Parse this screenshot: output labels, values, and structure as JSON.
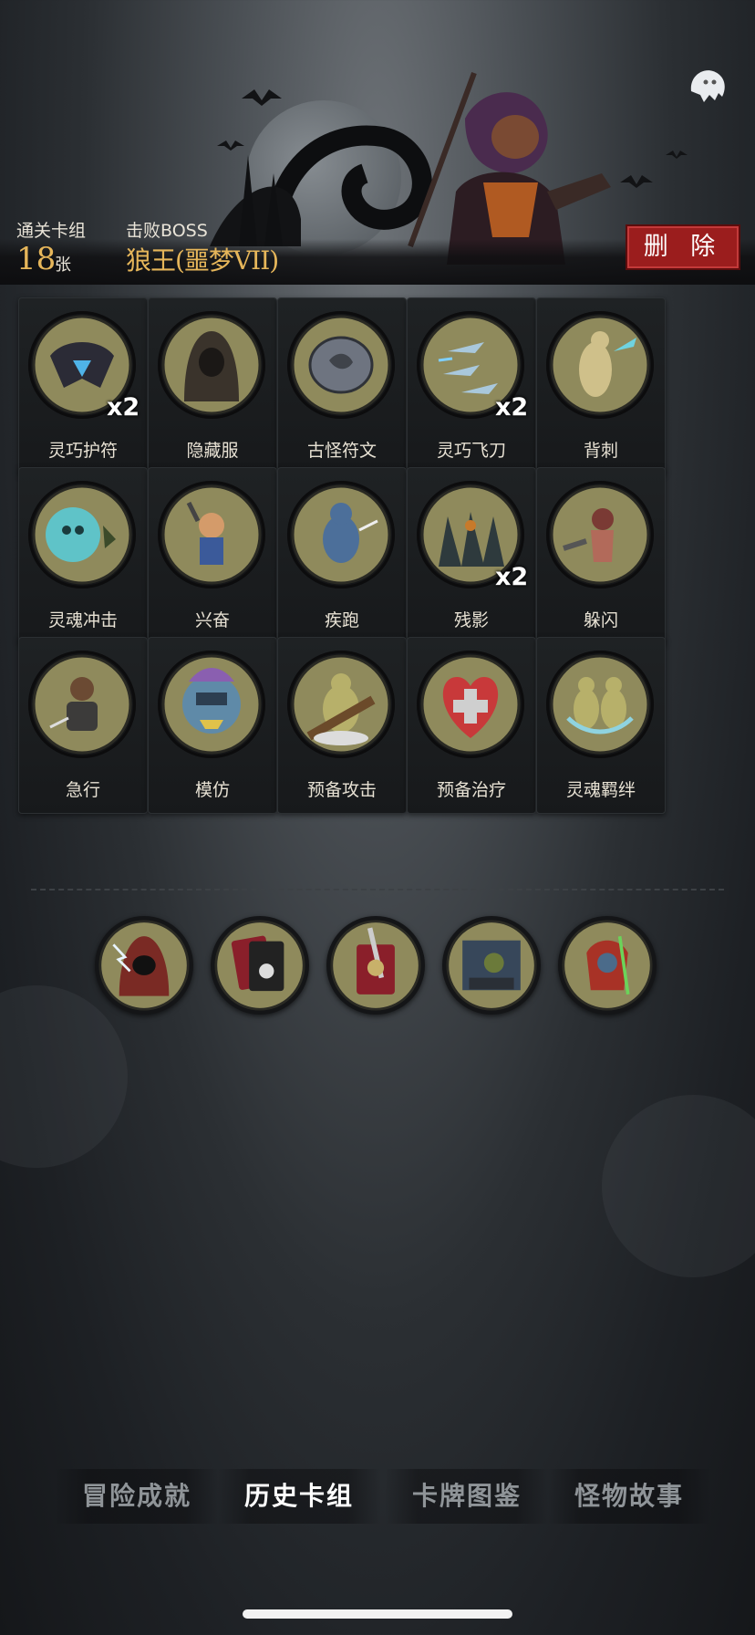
{
  "header": {
    "cleared_deck_label": "通关卡组",
    "card_count": "18",
    "card_unit": "张",
    "defeated_boss_label": "击败BOSS",
    "boss_name": "狼王(噩梦VII)",
    "delete_label": "删 除",
    "settings_icon": "ghost-icon"
  },
  "cards": [
    {
      "label": "灵巧护符",
      "badge": "x2",
      "icon": "dagger-amulet-icon"
    },
    {
      "label": "隐藏服",
      "badge": "",
      "icon": "hood-cloak-icon"
    },
    {
      "label": "古怪符文",
      "badge": "",
      "icon": "rune-stone-icon"
    },
    {
      "label": "灵巧飞刀",
      "badge": "x2",
      "icon": "flying-knives-icon"
    },
    {
      "label": "背刺",
      "badge": "",
      "icon": "backstab-icon"
    },
    {
      "label": "灵魂冲击",
      "badge": "",
      "icon": "soul-blast-icon"
    },
    {
      "label": "兴奋",
      "badge": "",
      "icon": "excited-dwarf-icon"
    },
    {
      "label": "疾跑",
      "badge": "",
      "icon": "sprint-icon"
    },
    {
      "label": "残影",
      "badge": "x2",
      "icon": "afterimage-icon"
    },
    {
      "label": "躲闪",
      "badge": "",
      "icon": "dodge-icon"
    },
    {
      "label": "急行",
      "badge": "",
      "icon": "rush-icon"
    },
    {
      "label": "模仿",
      "badge": "",
      "icon": "mimic-goblin-icon"
    },
    {
      "label": "预备攻击",
      "badge": "",
      "icon": "ready-attack-icon"
    },
    {
      "label": "预备治疗",
      "badge": "",
      "icon": "heart-heal-icon"
    },
    {
      "label": "灵魂羁绊",
      "badge": "",
      "icon": "soul-bond-icon"
    }
  ],
  "relics": [
    {
      "icon": "lightning-hood-icon"
    },
    {
      "icon": "skull-card-icon"
    },
    {
      "icon": "sword-card-icon"
    },
    {
      "icon": "treasure-room-icon"
    },
    {
      "icon": "jester-blade-icon"
    }
  ],
  "tabs": [
    {
      "label": "冒险成就",
      "active": false
    },
    {
      "label": "历史卡组",
      "active": true
    },
    {
      "label": "卡牌图鉴",
      "active": false
    },
    {
      "label": "怪物故事",
      "active": false
    }
  ],
  "colors": {
    "gold": "#e6b65a",
    "delete_red": "#9b1d1d",
    "medal_olive": "#8f8a5c"
  }
}
